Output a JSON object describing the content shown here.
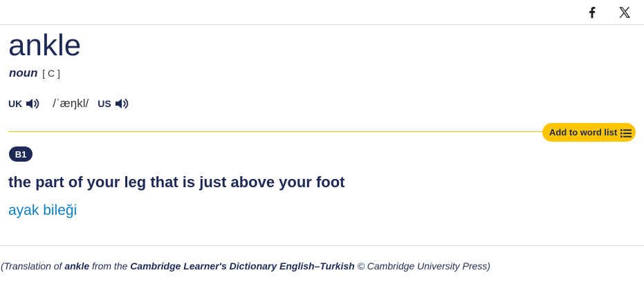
{
  "share": {
    "icons": [
      "facebook-icon",
      "x-icon"
    ]
  },
  "entry": {
    "headword": "ankle",
    "pos": "noun",
    "grammar": "[ C ]",
    "pron": {
      "uk_label": "UK",
      "us_label": "US",
      "ipa": "/ˈæŋkl/"
    },
    "add_to_word_list": "Add to word list",
    "level": "B1",
    "definition": "the part of your leg that is just above your foot",
    "translation": "ayak bileği"
  },
  "credit": {
    "prefix": "(Translation of ",
    "word": "ankle",
    "middle": " from the ",
    "dictionary": "Cambridge Learner's Dictionary English–Turkish",
    "suffix": " © Cambridge University Press)"
  },
  "colors": {
    "navy": "#1d2a57",
    "accent_yellow": "#fec400",
    "translation_blue": "#0e7fc6"
  }
}
